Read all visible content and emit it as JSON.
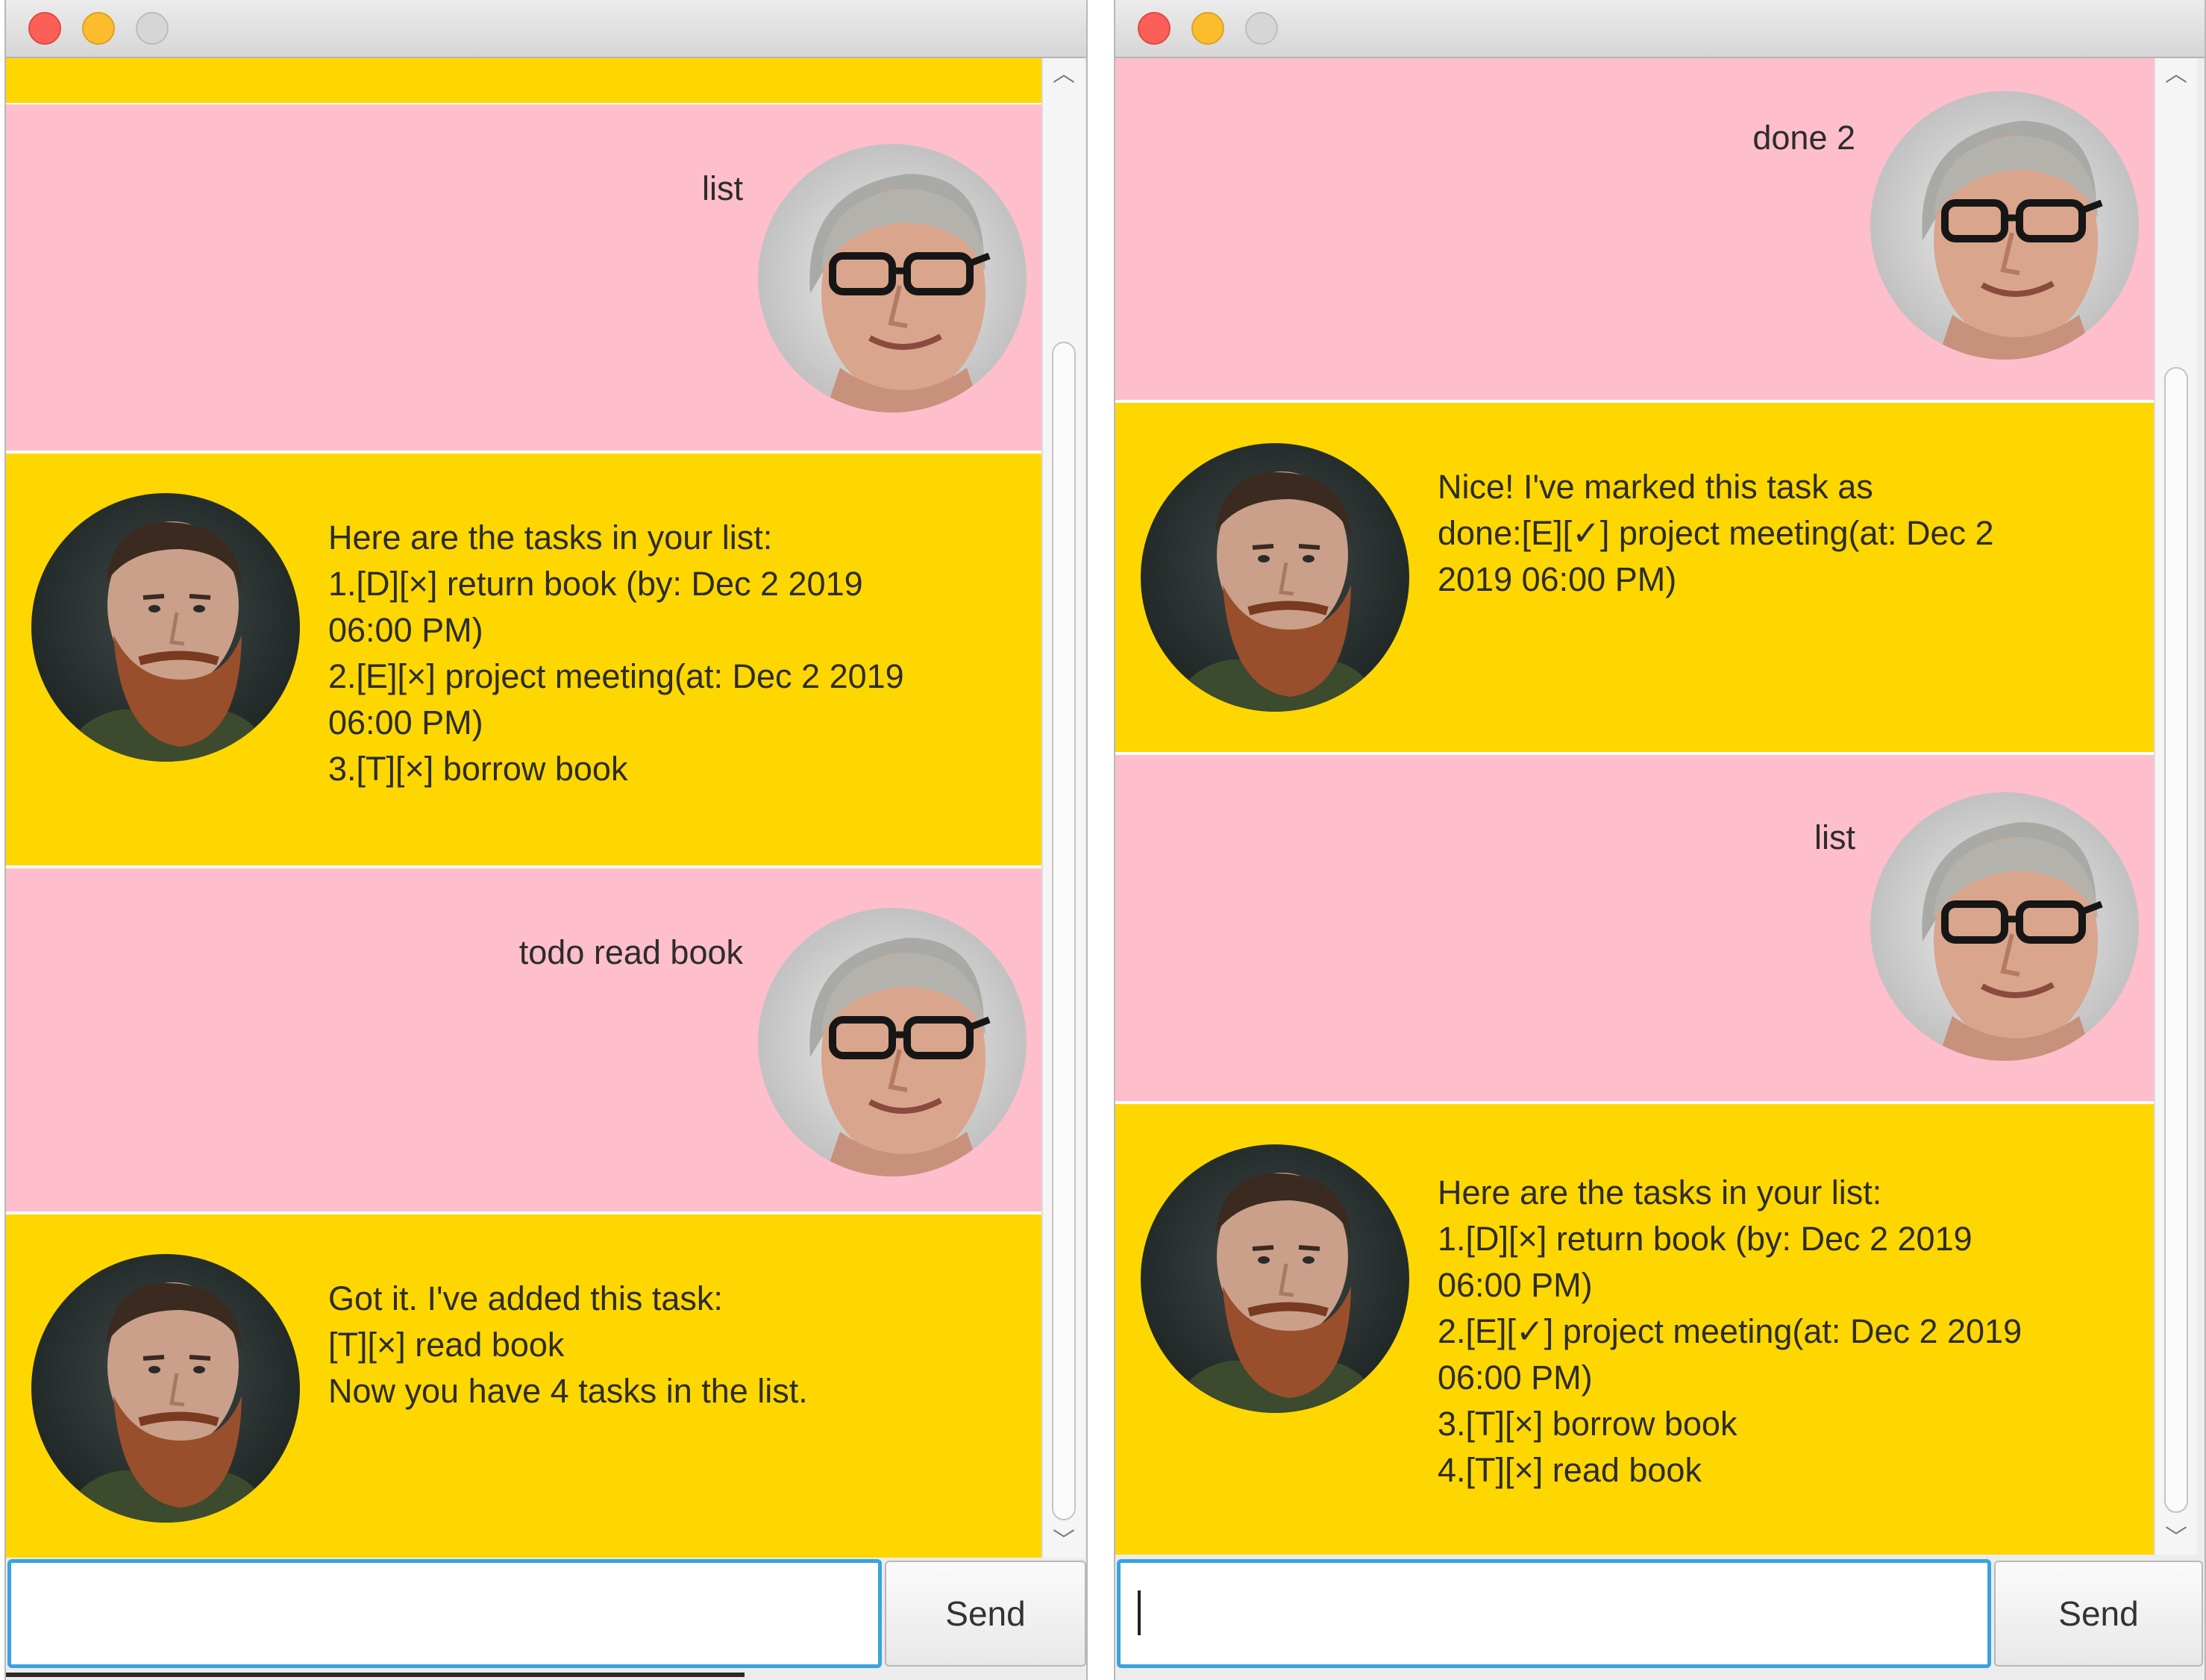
{
  "colors": {
    "user_bubble": "#ffbecb",
    "duke_bubble": "#ffd700",
    "input_focus": "#38a3e0",
    "close_light": "#fc5f57",
    "minimize_light": "#fdbc2e",
    "zoom_light": "#d6d6d6"
  },
  "icons": {
    "user_avatar": "gray-haired-man-with-glasses-avatar-icon",
    "duke_avatar": "bearded-man-avatar-icon",
    "scroll_up": "chevron-up-icon",
    "scroll_down": "chevron-down-icon"
  },
  "left_window": {
    "messages": [
      {
        "sender": "duke",
        "text": ""
      },
      {
        "sender": "user",
        "text": "list"
      },
      {
        "sender": "duke",
        "text": "Here are the tasks in your list:\n1.[D][×] return book (by: Dec 2 2019\n06:00 PM)\n2.[E][×] project meeting(at: Dec 2 2019\n06:00 PM)\n3.[T][×] borrow book"
      },
      {
        "sender": "user",
        "text": "todo read book"
      },
      {
        "sender": "duke",
        "text": "Got it. I've added this task:\n[T][×] read book\nNow you have 4 tasks in the list."
      }
    ],
    "input_value": "",
    "send_label": "Send"
  },
  "right_window": {
    "messages": [
      {
        "sender": "user",
        "text": "done 2"
      },
      {
        "sender": "duke",
        "text": "Nice! I've marked this task as\ndone:[E][✓] project meeting(at: Dec 2\n2019 06:00 PM)"
      },
      {
        "sender": "user",
        "text": "list"
      },
      {
        "sender": "duke",
        "text": "Here are the tasks in your list:\n1.[D][×] return book (by: Dec 2 2019\n06:00 PM)\n2.[E][✓] project meeting(at: Dec 2 2019\n06:00 PM)\n3.[T][×] borrow book\n4.[T][×] read book"
      }
    ],
    "input_value": "",
    "send_label": "Send"
  }
}
